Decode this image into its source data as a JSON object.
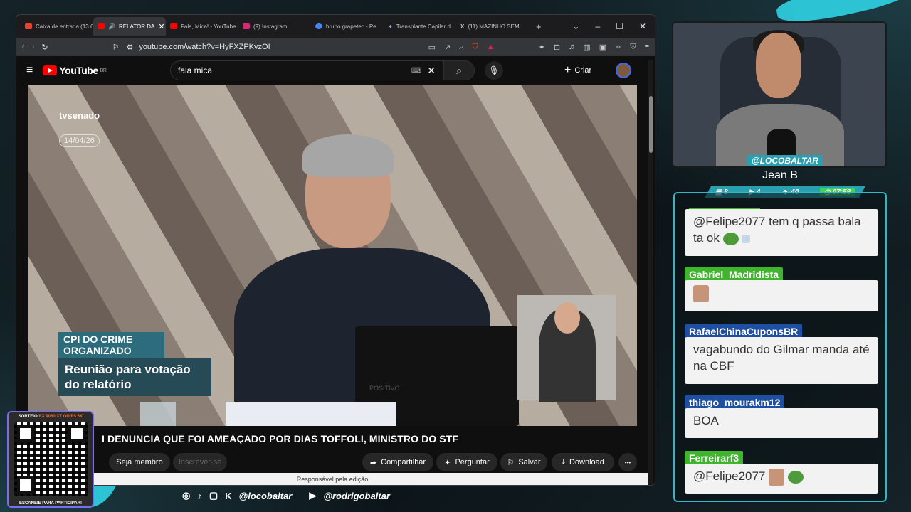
{
  "browser": {
    "tabs": [
      {
        "label": "Caixa de entrada (13.6",
        "color": "#ea4335",
        "active": false
      },
      {
        "label": "RELATOR DA",
        "color": "#ff0000",
        "active": true
      },
      {
        "label": "Fala, Mica! - YouTube",
        "color": "#ff0000",
        "active": false
      },
      {
        "label": "(9) Instagram",
        "color": "#d62976",
        "active": false
      },
      {
        "label": "bruno grapetec - Pe",
        "color": "#4285f4",
        "active": false
      },
      {
        "label": "Transplante Capilar d",
        "color": "#8ab4f8",
        "active": false
      },
      {
        "label": "(11) MAZINHO SEM",
        "color": "#ffffff",
        "active": false
      }
    ],
    "new_tab": "+",
    "url": "youtube.com/watch?v=HyFXZPKvzOI"
  },
  "youtube": {
    "logo": "YouTube",
    "region": "BR",
    "search_value": "fala mica",
    "create_label": "Criar",
    "video": {
      "channel_logo": "tvsenado",
      "date": "14/04/26",
      "caption_top": "CPI DO CRIME ORGANIZADO",
      "caption_main": "Reunião para votação do relatório",
      "plaque_text": "POSITIVO"
    },
    "title": "I DENUNCIA QUE FOI AMEAÇADO POR DIAS TOFFOLI, MINISTRO DO STF",
    "actions": {
      "member": "Seja membro",
      "subscribe": "Inscrever-se",
      "share": "Compartilhar",
      "ask": "Perguntar",
      "save": "Salvar",
      "download": "Download",
      "more": "•••"
    },
    "note": "Responsável pela edição"
  },
  "overlay": {
    "socials": {
      "handle1": "@locobaltar",
      "handle2": "@rodrigobaltar"
    },
    "cam_handle": "@LOCOBALTAR",
    "name": "Jean B",
    "stats": {
      "subs": "8",
      "videos": "4",
      "viewers": "40",
      "time": "07:58"
    },
    "qr": {
      "top_prefix": "SORTEIO ",
      "top_highlight": "RX 9060 XT OU R$ 6K",
      "bottom": "ESCANEIE PARA PARTICIPAR!"
    }
  },
  "chat": [
    {
      "user": "",
      "text": "@Felipe2077 tem q passa bala ta ok",
      "color": ""
    },
    {
      "user": "Gabriel_Madridista",
      "text": "",
      "color": "#3fb52e"
    },
    {
      "user": "RafaelChinaCuponsBR",
      "text": "vagabundo do Gilmar manda até na CBF",
      "color": "#1f4fa0"
    },
    {
      "user": "thiago_mourakm12",
      "text": "BOA",
      "color": "#1f4fa0"
    },
    {
      "user": "Ferreirarf3",
      "text": "@Felipe2077",
      "color": "#3fb52e"
    }
  ]
}
